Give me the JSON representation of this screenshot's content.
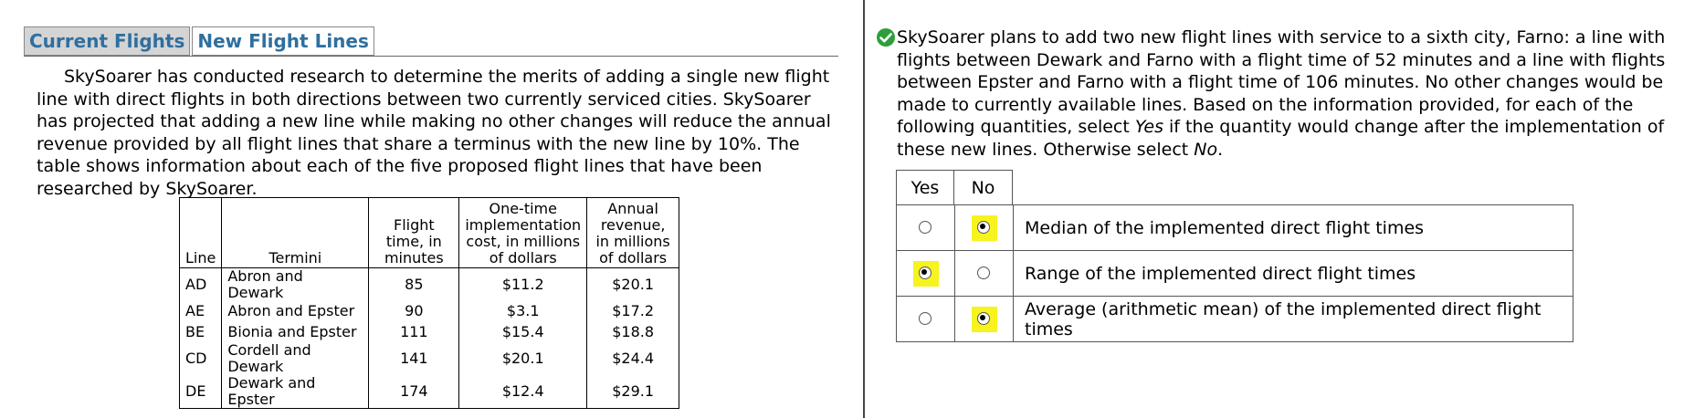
{
  "tabs": [
    {
      "label": "Current Flights",
      "active": true
    },
    {
      "label": "New Flight Lines",
      "active": false
    }
  ],
  "passage": "SkySoarer has conducted research to determine the merits of adding a single new flight line with direct flights in both directions between two currently serviced cities. SkySoarer has projected that adding a new line while making no other changes will reduce the annual revenue provided by all flight lines that share a terminus with the new line by 10%. The table shows information about each of the five proposed flight lines that have been researched by SkySoarer.",
  "table": {
    "headers": [
      "Line",
      "Termini",
      "Flight time, in minutes",
      "One-time implementation cost, in millions of dollars",
      "Annual revenue, in millions of dollars"
    ],
    "rows": [
      [
        "AD",
        "Abron and Dewark",
        "85",
        "$11.2",
        "$20.1"
      ],
      [
        "AE",
        "Abron and Epster",
        "90",
        "$3.1",
        "$17.2"
      ],
      [
        "BE",
        "Bionia and Epster",
        "111",
        "$15.4",
        "$18.8"
      ],
      [
        "CD",
        "Cordell and Dewark",
        "141",
        "$20.1",
        "$24.4"
      ],
      [
        "DE",
        "Dewark and Epster",
        "174",
        "$12.4",
        "$29.1"
      ]
    ]
  },
  "question": {
    "part1": "SkySoarer plans to add two new flight lines with service to a sixth city, Farno: a line with flights between Dewark and Farno with a flight time of 52 minutes and a line with flights between Epster and Farno with a flight time of 106 minutes. No other changes would be made to currently available lines. Based on the information provided, for each of the following quantities, select ",
    "yes_word": "Yes",
    "part2": " if the quantity would change after the implementation of these new lines. Otherwise select ",
    "no_word": "No",
    "part3": "."
  },
  "answer_headers": {
    "yes": "Yes",
    "no": "No"
  },
  "statements": [
    {
      "text": "Median of the implemented direct flight times",
      "selected": "no"
    },
    {
      "text": "Range of the implemented direct flight times",
      "selected": "yes"
    },
    {
      "text": "Average (arithmetic mean) of the implemented direct flight times",
      "selected": "no"
    }
  ],
  "icons": {
    "answered": "check-circle-icon"
  },
  "colors": {
    "tab_text": "#2f6f9f",
    "check": "#2e9e3a",
    "highlight": "#f7f31e"
  }
}
